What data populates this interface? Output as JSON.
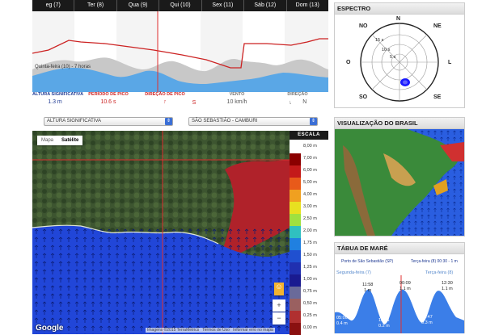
{
  "day_tabs": [
    "eg (7)",
    "Ter (8)",
    "Qua (9)",
    "Qui (10)",
    "Sex (11)",
    "Sáb (12)",
    "Dom (13)"
  ],
  "chart": {
    "cursor_label": "Quinta-feira (10) - 7 horas",
    "colors": {
      "period_line": "#cc2222",
      "wave_area": "#5aa7e6",
      "wind_area": "#c8c8c8",
      "cursor": "#e03030"
    }
  },
  "metrics": [
    {
      "label": "ALTURA SIGNIFICATIVA",
      "value": "1.3 m"
    },
    {
      "label": "PERÍODO DE PICO",
      "value": "10.6 s"
    },
    {
      "label": "DIREÇÃO DE PICO",
      "value": "",
      "icon": "wave-direction-arrow-icon"
    },
    {
      "label": "",
      "value": "S"
    },
    {
      "label": "VENTO",
      "value": "10 km/h"
    },
    {
      "label": "DIREÇÃO",
      "value": "N",
      "icon": "wind-direction-arrow-icon"
    }
  ],
  "selects": {
    "variable": "ALTURA SIGNIFICATIVA",
    "location": "SÃO SEBASTIÃO - CAMBURI"
  },
  "map": {
    "tabs": [
      "Mapa",
      "Satélite"
    ],
    "active_tab": "Satélite",
    "zoom_in": "+",
    "zoom_out": "−",
    "google_logo": "Google",
    "attribution": "Imagens ©2015 TerraMetrics",
    "terms": "Termos de Uso",
    "report": "Informar erro no mapa"
  },
  "scale": {
    "title": "ESCALA",
    "entries": [
      {
        "label": "8,00 m",
        "color": "#ffffff"
      },
      {
        "label": "7,00 m",
        "color": "#8b0000"
      },
      {
        "label": "6,00 m",
        "color": "#c41a1a"
      },
      {
        "label": "5,00 m",
        "color": "#e85a1a"
      },
      {
        "label": "4,00 m",
        "color": "#f0a020"
      },
      {
        "label": "3,00 m",
        "color": "#e8e020"
      },
      {
        "label": "2,50 m",
        "color": "#a0e040"
      },
      {
        "label": "2,00 m",
        "color": "#30c0c0"
      },
      {
        "label": "1,75 m",
        "color": "#2080e0"
      },
      {
        "label": "1,50 m",
        "color": "#2050d0"
      },
      {
        "label": "1,25 m",
        "color": "#2030b0"
      },
      {
        "label": "1,00 m",
        "color": "#1a1a90"
      },
      {
        "label": "0,75 m",
        "color": "#6a6a9a"
      },
      {
        "label": "0,50 m",
        "color": "#9a6060"
      },
      {
        "label": "0,25 m",
        "color": "#b03030"
      },
      {
        "label": "0,00 m",
        "color": "#8a1010"
      }
    ]
  },
  "spectro": {
    "title": "ESPECTRO",
    "directions": {
      "n": "N",
      "ne": "NE",
      "l": "L",
      "se": "SE",
      "so": "SO",
      "o": "O",
      "no": "NO"
    },
    "rings": [
      "15 s",
      "10 s",
      "5 s"
    ]
  },
  "brasil": {
    "title": "VISUALIZAÇÃO DO BRASIL"
  },
  "tide": {
    "title": "TÁBUA DE MARÉ",
    "port": "Porto de São Sebastião (SP)",
    "now": "Terça-feira (8) 00:30 - 1 m",
    "day_left": "Segunda-feira (7)",
    "day_right": "Terça-feira (8)",
    "points": [
      {
        "time": "11:58",
        "height": "1 m"
      },
      {
        "time": "00:09",
        "height": "1.1 m"
      },
      {
        "time": "12:30",
        "height": "1.1 m"
      },
      {
        "time": "05:00",
        "height": "0.4 m"
      },
      {
        "time": "18:21",
        "height": "0.2 m"
      },
      {
        "time": "06:47",
        "height": "0.3 m"
      }
    ]
  }
}
